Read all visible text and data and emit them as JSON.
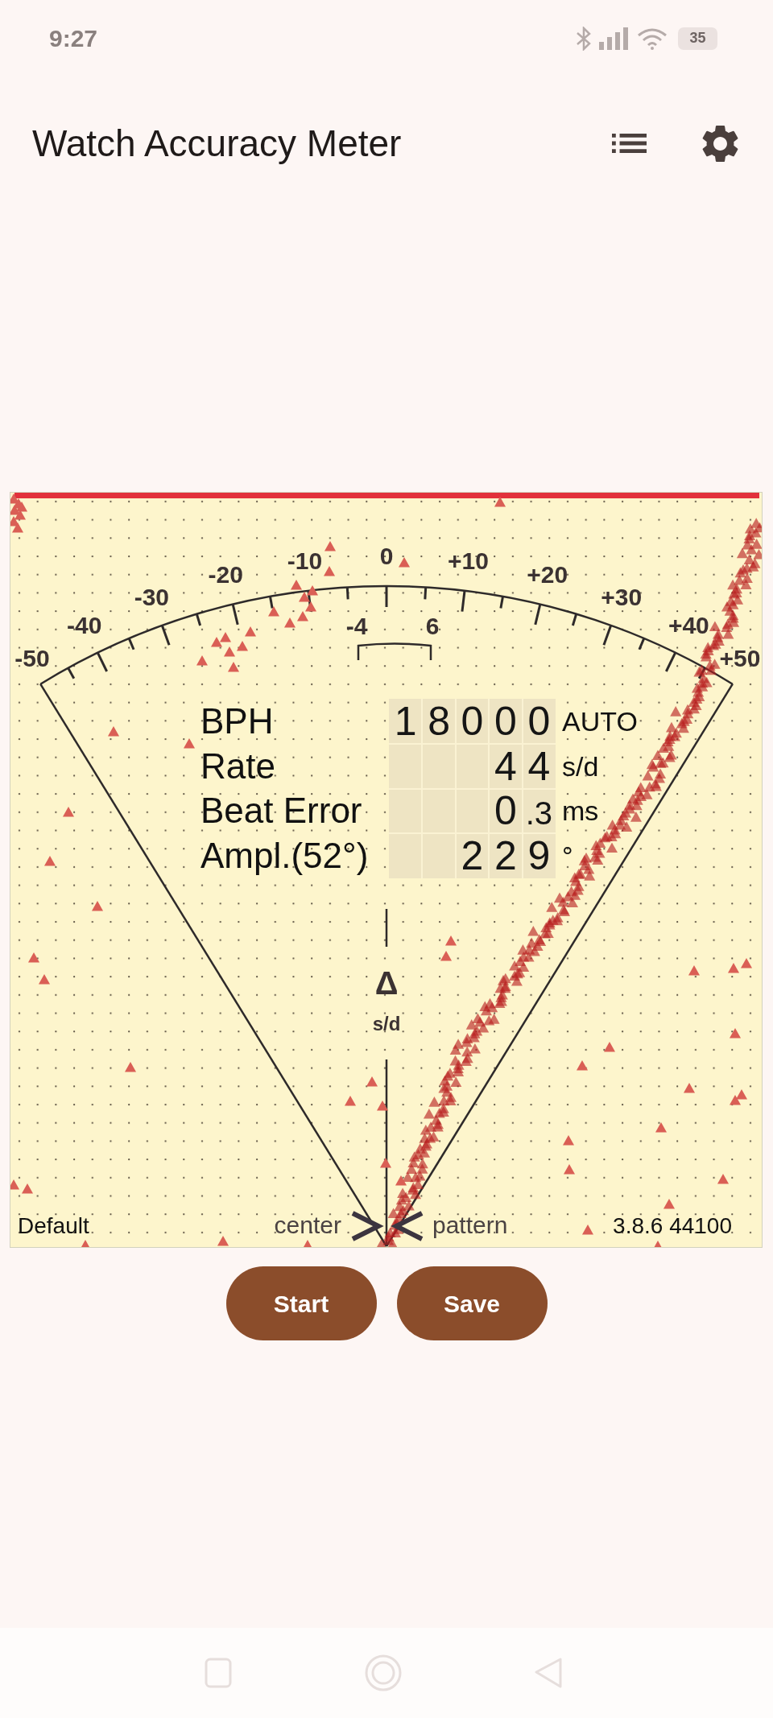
{
  "status_bar": {
    "time": "9:27",
    "battery": "35"
  },
  "app_bar": {
    "title": "Watch Accuracy Meter"
  },
  "meter": {
    "scale_labels": [
      "-50",
      "-40",
      "-30",
      "-20",
      "-10",
      "0",
      "+10",
      "+20",
      "+30",
      "+40",
      "+50"
    ],
    "tolerance_labels": [
      "-4",
      "6"
    ],
    "axis_symbol": "Δ",
    "axis_unit": "s/d",
    "readouts": [
      {
        "label": "BPH",
        "value": "18000",
        "unit": "AUTO"
      },
      {
        "label": "Rate",
        "value": "44",
        "unit": "s/d"
      },
      {
        "label": "Beat Error",
        "value": "0.3",
        "unit": "ms"
      },
      {
        "label": "Ampl.(52°)",
        "value": "229",
        "unit": "°"
      }
    ],
    "footer": {
      "profile": "Default",
      "center_label": "center",
      "pattern_label": "pattern",
      "version": "3.8.6 44100"
    }
  },
  "buttons": [
    "Start",
    "Save"
  ]
}
